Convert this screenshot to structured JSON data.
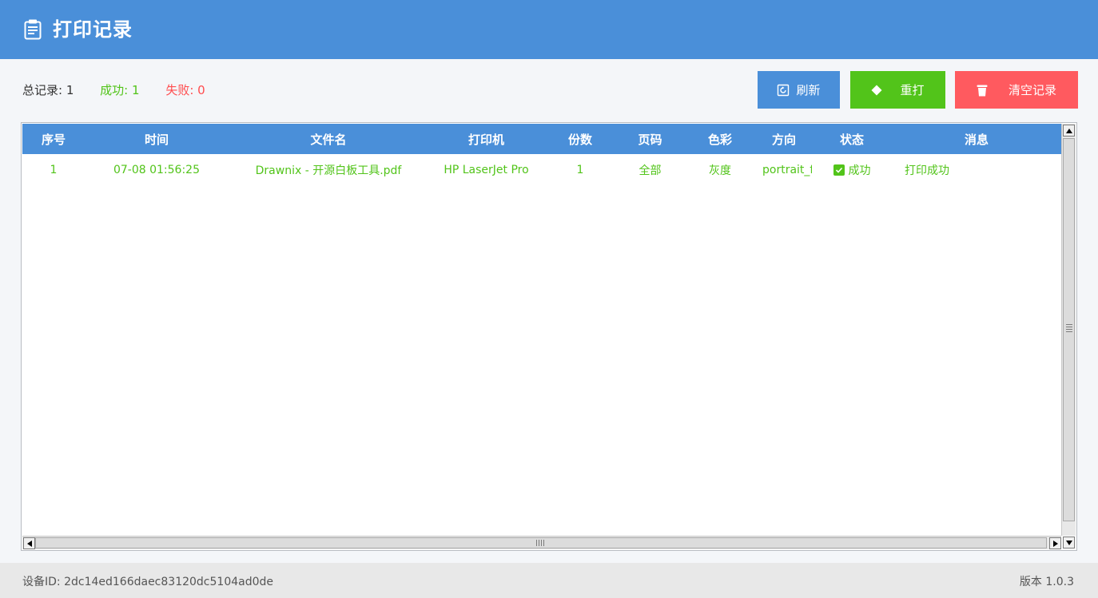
{
  "header": {
    "title": "打印记录",
    "icon": "clipboard-icon"
  },
  "stats": {
    "total": "总记录: 1",
    "success": "成功: 1",
    "fail": "失败: 0"
  },
  "toolbar": {
    "refresh_label": "刷新",
    "refresh_icon": "refresh-icon",
    "reprint_label": "重打",
    "reprint_icon": "diamond-icon",
    "clear_label": "清空记录",
    "clear_icon": "trash-icon"
  },
  "colors": {
    "primary": "#4a8fd9",
    "success": "#52c41a",
    "danger": "#ff5a5f"
  },
  "table": {
    "columns": [
      "序号",
      "时间",
      "文件名",
      "打印机",
      "份数",
      "页码",
      "色彩",
      "方向",
      "状态",
      "消息"
    ],
    "rows": [
      [
        "1",
        "07-08 01:56:25",
        "Drawnix - 开源白板工具.pdf",
        "HP LaserJet Pro",
        "1",
        "全部",
        "灰度",
        "portrait_f",
        "成功",
        "打印成功"
      ]
    ]
  },
  "footer": {
    "device_id": "设备ID: 2dc14ed166daec83120dc5104ad0de",
    "version": "版本 1.0.3"
  }
}
